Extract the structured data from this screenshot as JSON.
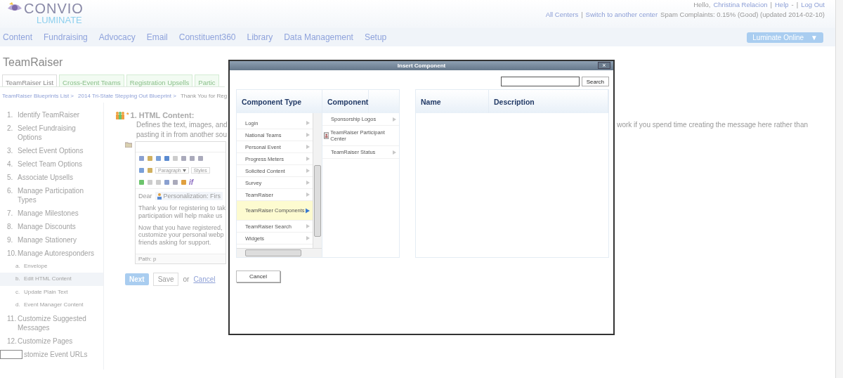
{
  "logo": {
    "brand": "CONVIO",
    "product": "LUMINATE"
  },
  "user_bar": [
    {
      "text": "Hello,",
      "kind": "text"
    },
    {
      "text": "Christina Relacion",
      "kind": "link"
    },
    {
      "text": "|",
      "kind": "sep"
    },
    {
      "text": "Help",
      "kind": "link"
    },
    {
      "text": "-",
      "kind": "text"
    },
    {
      "text": "|",
      "kind": "sep"
    },
    {
      "text": "Log Out",
      "kind": "link"
    }
  ],
  "center_bar": [
    {
      "text": "All Centers",
      "kind": "link"
    },
    {
      "text": "|",
      "kind": "sep"
    },
    {
      "text": "Switch to another center",
      "kind": "link"
    },
    {
      "text": "Spam Complaints: 0.15% (Good) (updated 2014-02-10)",
      "kind": "text"
    }
  ],
  "nav": [
    "Content",
    "Fundraising",
    "Advocacy",
    "Email",
    "Constituent360",
    "Library",
    "Data Management",
    "Setup"
  ],
  "product_menu": {
    "label": "Luminate Online",
    "caret": "▼"
  },
  "page_title": "TeamRaiser",
  "tabs": [
    {
      "label": "TeamRaiser List",
      "selected": true
    },
    {
      "label": "Cross-Event Teams",
      "selected": false
    },
    {
      "label": "Registration Upsells",
      "selected": false
    },
    {
      "label": "Partic",
      "selected": false
    }
  ],
  "breadcrumb": [
    {
      "text": "TeamRaiser Blueprints List >",
      "kind": "link"
    },
    {
      "text": "2014 Tri-State Stepping Out Blueprint >",
      "kind": "link"
    },
    {
      "text": "Thank You for Reg",
      "kind": "text"
    }
  ],
  "steps": [
    {
      "number": "1.",
      "label": "Identify TeamRaiser",
      "selected": false
    },
    {
      "number": "2.",
      "label": "Select Fundraising Options",
      "selected": false
    },
    {
      "number": "3.",
      "label": "Select Event Options",
      "selected": false
    },
    {
      "number": "4.",
      "label": "Select Team Options",
      "selected": false
    },
    {
      "number": "5.",
      "label": "Associate Upsells",
      "selected": false
    },
    {
      "number": "6.",
      "label": "Manage Participation Types",
      "selected": false
    },
    {
      "number": "7.",
      "label": "Manage Milestones",
      "selected": false
    },
    {
      "number": "8.",
      "label": "Manage Discounts",
      "selected": false
    },
    {
      "number": "9.",
      "label": "Manage Stationery",
      "selected": false
    },
    {
      "number": "10.",
      "label": "Manage Autoresponders",
      "selected": false,
      "children": [
        {
          "number": "a.",
          "label": "Envelope",
          "selected": false
        },
        {
          "number": "b.",
          "label": "Edit HTML Content",
          "selected": true
        },
        {
          "number": "c.",
          "label": "Update Plain Text",
          "selected": false
        },
        {
          "number": "d.",
          "label": "Event Manager Content",
          "selected": false
        }
      ]
    },
    {
      "number": "11.",
      "label": "Customize Suggested Messages",
      "selected": false
    },
    {
      "number": "12.",
      "label": "Customize Pages",
      "selected": false
    },
    {
      "label": "stomize Event URLs",
      "selected": false
    }
  ],
  "section": {
    "required_mark": "*",
    "title": "1. HTML Content:",
    "description_left": "Defines the text, images, and",
    "description_right": "work if you spend time creating the message here rather than",
    "description_line2": "pasting it in from another sou"
  },
  "editor": {
    "format": "Paragraph",
    "styles": "Styles",
    "condition": "if",
    "greeting": "Dear",
    "token": "Personalization: Firs",
    "paragraphs": [
      [
        "Thank you for registering to tak",
        "participation will help make us"
      ],
      [
        "Now that you have registered,",
        "customize your personal webp",
        "friends asking for support."
      ]
    ],
    "path": "Path: p"
  },
  "actions": {
    "next": "Next",
    "save": "Save",
    "or": "or",
    "cancel": "Cancel"
  },
  "dialog": {
    "title": "Insert Component",
    "close": "×",
    "search_button": "Search",
    "type_header": "Component Type",
    "component_header": "Component",
    "types": [
      {
        "label": "Login",
        "selected": false
      },
      {
        "label": "National Teams",
        "selected": false
      },
      {
        "label": "Personal Event",
        "selected": false
      },
      {
        "label": "Progress Meters",
        "selected": false
      },
      {
        "label": "Solicited Content",
        "selected": false
      },
      {
        "label": "Survey",
        "selected": false
      },
      {
        "label": "TeamRaiser",
        "selected": false
      },
      {
        "label": "TeamRaiser Components",
        "selected": true
      },
      {
        "label": "TeamRaiser Search",
        "selected": false
      },
      {
        "label": "Widgets",
        "selected": false
      }
    ],
    "components": [
      {
        "label": "Sponsorship Logos",
        "kind": "folder"
      },
      {
        "label": "TeamRaiser Participant Center",
        "kind": "item"
      },
      {
        "label": "TeamRaiser Status",
        "kind": "folder"
      }
    ],
    "columns": [
      "Name",
      "Description"
    ],
    "cancel": "Cancel"
  }
}
